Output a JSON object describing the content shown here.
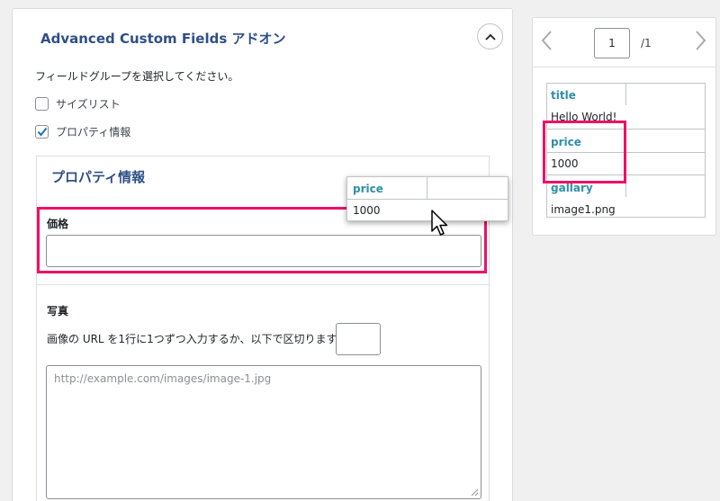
{
  "main": {
    "title": "Advanced Custom Fields アドオン",
    "instruction": "フィールドグループを選択してください。",
    "checkboxes": [
      {
        "label": "サイズリスト",
        "checked": false
      },
      {
        "label": "プロパティ情報",
        "checked": true
      }
    ],
    "group": {
      "title": "プロパティ情報",
      "price_label": "価格",
      "price_value": "",
      "photo_label": "写真",
      "photo_description": "画像の URL を1行に1つずつ入力するか、以下で区切ります:",
      "separator_value": "",
      "textarea_placeholder": "http://example.com/images/image-1.jpg"
    }
  },
  "popup": {
    "label": "price",
    "value": "1000"
  },
  "side": {
    "page_current": "1",
    "page_total": "/1",
    "rows": [
      {
        "label": "title",
        "value": "Hello World!"
      },
      {
        "label": "price",
        "value": "1000"
      },
      {
        "label": "gallary",
        "value": "image1.png"
      }
    ]
  },
  "colors": {
    "accent": "#2f4f86",
    "field_label": "#2e8fa8",
    "highlight": "#ed1166"
  },
  "icons": {
    "collapse": "chevron-up-icon",
    "prev": "chevron-left-icon",
    "next": "chevron-right-icon",
    "cursor": "mouse-pointer-icon",
    "check": "checkmark-icon"
  }
}
